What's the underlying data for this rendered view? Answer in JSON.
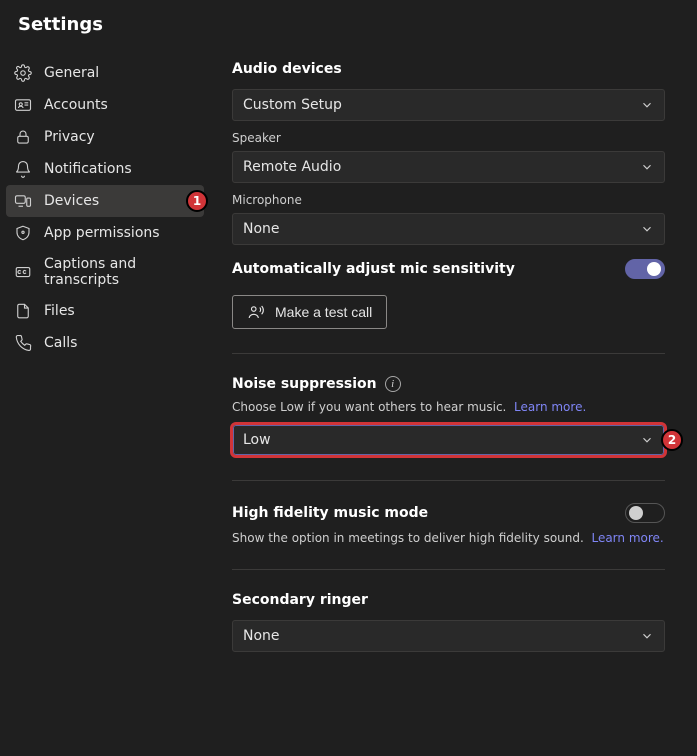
{
  "title": "Settings",
  "sidebar": {
    "items": [
      {
        "label": "General",
        "icon": "gear-icon",
        "active": false
      },
      {
        "label": "Accounts",
        "icon": "accounts-icon",
        "active": false
      },
      {
        "label": "Privacy",
        "icon": "lock-icon",
        "active": false
      },
      {
        "label": "Notifications",
        "icon": "bell-icon",
        "active": false
      },
      {
        "label": "Devices",
        "icon": "devices-icon",
        "active": true,
        "badge": "1"
      },
      {
        "label": "App permissions",
        "icon": "shield-icon",
        "active": false
      },
      {
        "label": "Captions and transcripts",
        "icon": "captions-icon",
        "active": false
      },
      {
        "label": "Files",
        "icon": "file-icon",
        "active": false
      },
      {
        "label": "Calls",
        "icon": "call-icon",
        "active": false
      }
    ]
  },
  "content": {
    "audio_devices": {
      "title": "Audio devices",
      "device_value": "Custom Setup",
      "speaker_label": "Speaker",
      "speaker_value": "Remote Audio",
      "microphone_label": "Microphone",
      "microphone_value": "None"
    },
    "auto_mic": {
      "label": "Automatically adjust mic sensitivity",
      "on": true
    },
    "test_call_label": "Make a test call",
    "noise": {
      "title": "Noise suppression",
      "desc": "Choose Low if you want others to hear music.",
      "learn_more": "Learn more.",
      "value": "Low",
      "badge": "2"
    },
    "hifi": {
      "title": "High fidelity music mode",
      "desc": "Show the option in meetings to deliver high fidelity sound.",
      "learn_more": "Learn more.",
      "on": false
    },
    "ringer": {
      "title": "Secondary ringer",
      "value": "None"
    }
  },
  "colors": {
    "accent": "#6264a7",
    "danger": "#d13438"
  }
}
